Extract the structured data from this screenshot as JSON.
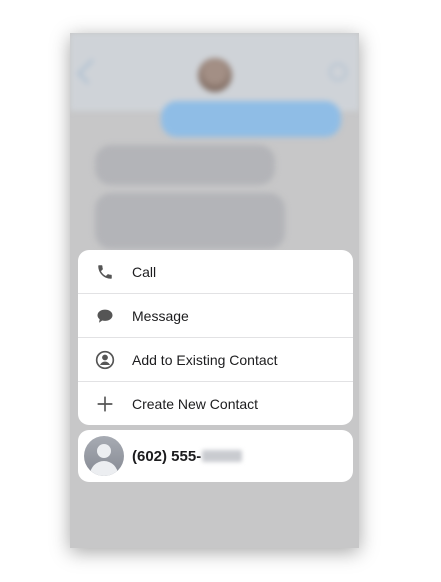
{
  "menu": {
    "items": [
      {
        "label": "Call",
        "icon": "phone-icon"
      },
      {
        "label": "Message",
        "icon": "speech-bubble-icon"
      },
      {
        "label": "Add to Existing Contact",
        "icon": "person-circle-icon"
      },
      {
        "label": "Create New Contact",
        "icon": "plus-icon"
      }
    ]
  },
  "contact": {
    "number_prefix": "(602) 555-",
    "icon": "contact-avatar-icon"
  },
  "colors": {
    "sheet": "#ffffff",
    "dim_overlay": "#c7c7c8",
    "icon": "#555555"
  }
}
